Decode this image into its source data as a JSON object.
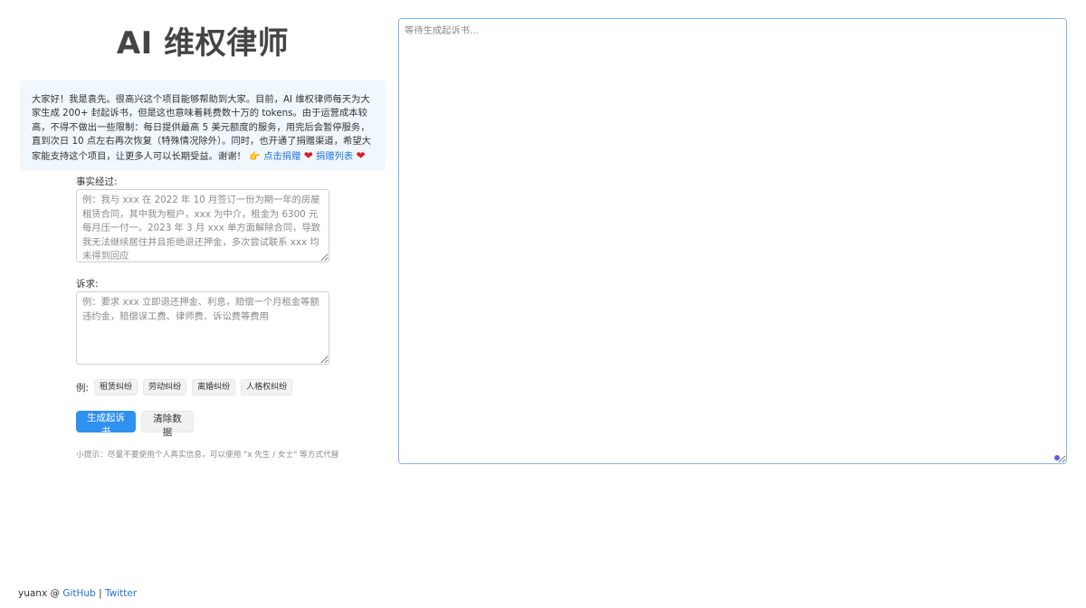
{
  "header": {
    "title": "AI 维权律师"
  },
  "notice": {
    "text": "大家好！我是袁先。很高兴这个项目能够帮助到大家。目前，AI 维权律师每天为大家生成 200+ 封起诉书，但是这也意味着耗费数十万的 tokens。由于运营成本较高，不得不做出一些限制：每日提供最高 5 美元额度的服务，用完后会暂停服务，直到次日 10 点左右再次恢复（特殊情况除外）。同时，也开通了捐赠渠道，希望大家能支持这个项目，让更多人可以长期受益。谢谢！",
    "pointer_icon": "👉",
    "donate_link": "点击捐赠",
    "heart_icon": "❤",
    "donors_link": "捐赠列表"
  },
  "form": {
    "facts_label": "事实经过:",
    "facts_placeholder": "例：我与 xxx 在 2022 年 10 月签订一份为期一年的房屋租赁合同，其中我为租户，xxx 为中介，租金为 6300 元每月压一付一。2023 年 3 月 xxx 单方面解除合同，导致我无法继续居住并且拒绝退还押金，多次尝试联系 xxx 均未得到回应",
    "claims_label": "诉求:",
    "claims_placeholder": "例：要求 xxx 立即退还押金、利息，赔偿一个月租金等额违约金，赔偿误工费、律师费、诉讼费等费用",
    "examples_label": "例:",
    "example_tags": [
      "租赁纠纷",
      "劳动纠纷",
      "离婚纠纷",
      "人格权纠纷"
    ],
    "generate_button": "生成起诉书",
    "clear_button": "清除数据",
    "hint": "小提示：尽量不要使用个人真实信息，可以使用 \"x 先生 / 女士\" 等方式代替"
  },
  "output": {
    "placeholder": "等待生成起诉书..."
  },
  "footer": {
    "author": "yuanx @",
    "github_link": "GitHub",
    "separator": "|",
    "twitter_link": "Twitter"
  },
  "colors": {
    "primary": "#2e90ef",
    "link": "#1e73d8",
    "notice_bg": "#f0f7fd",
    "output_border": "#7fb7ee"
  }
}
